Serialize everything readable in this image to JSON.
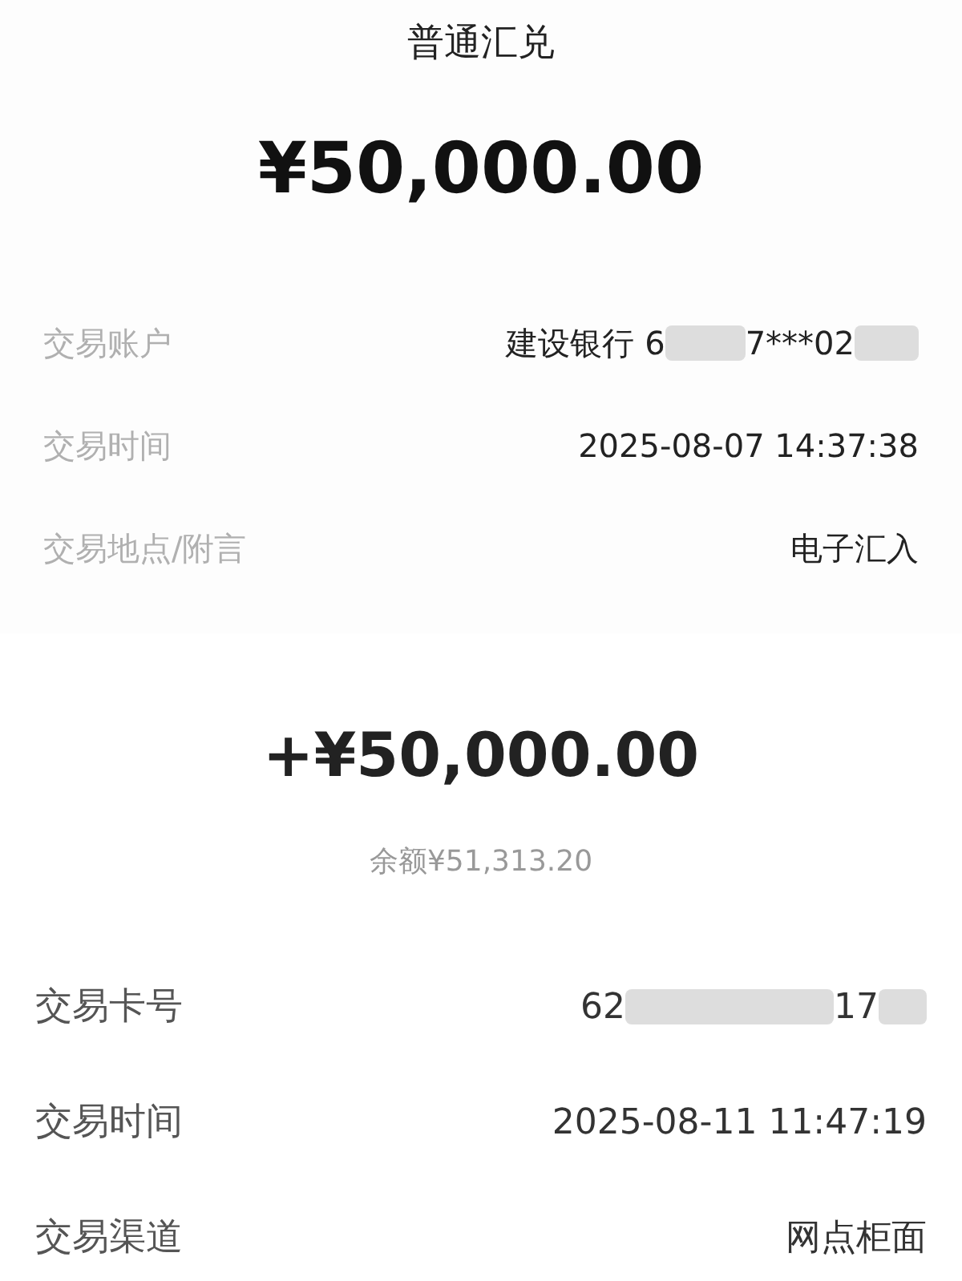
{
  "transfer": {
    "title": "普通汇兑",
    "amount": "¥50,000.00",
    "rows": [
      {
        "label": "交易账户",
        "kind": "masked",
        "value_start": "建设银行 6",
        "value_end": "7***02"
      },
      {
        "label": "交易时间",
        "kind": "plain",
        "value": "2025-08-07 14:37:38"
      },
      {
        "label": "交易地点/附言",
        "kind": "plain",
        "value": "电子汇入"
      }
    ]
  },
  "deposit": {
    "amount": "+¥50,000.00",
    "balance": "余额¥51,313.20",
    "rows": [
      {
        "label": "交易卡号",
        "kind": "masked",
        "value_start": "62",
        "value_end": "17"
      },
      {
        "label": "交易时间",
        "kind": "plain",
        "value": "2025-08-11 11:47:19"
      },
      {
        "label": "交易渠道",
        "kind": "plain",
        "value": "网点柜面"
      }
    ]
  }
}
